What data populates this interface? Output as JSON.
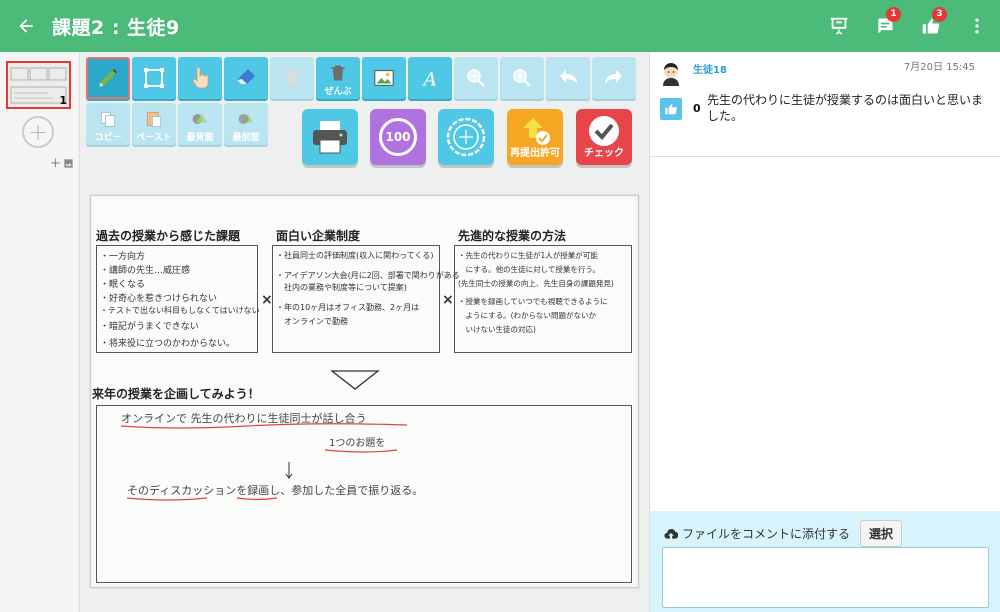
{
  "header": {
    "title": "課題2 : 生徒9",
    "badges": {
      "comments": "1",
      "likes": "3"
    }
  },
  "pages": {
    "current_number": "1"
  },
  "toolbar": {
    "delete_all_label": "ぜんぶ",
    "copy_label": "コピー",
    "paste_label": "ペースト",
    "back_label": "最背面",
    "front_label": "最前面",
    "score_label": "100",
    "resubmit_label": "再提出許可",
    "check_label": "チェック"
  },
  "document": {
    "heading1": "過去の授業から感じた課題",
    "heading2": "面白い企業制度",
    "heading3": "先進的な授業の方法",
    "heading4": "来年の授業を企画してみよう！",
    "cross": "×",
    "col1": [
      "・一方向方",
      "・講師の先生…威圧感",
      "・眠くなる",
      "・好奇心を惹きつけられない",
      "・テストで出ない科目もしなくてはいけない",
      "・暗記がうまくできない",
      "・将来役に立つのかわからない。"
    ],
    "col2": [
      "・社員同士の評価制度(収入に関わってくる)",
      "・アイデアソン大会(月に2回、部署で関わりがある",
      "　社内の業務や制度等について提案)",
      "・年の10ヶ月はオフィス勤務、2ヶ月は",
      "　オンラインで勤務"
    ],
    "col3": [
      "・先生の代わりに生徒が1人が授業が可能",
      "　にする。他の生徒に対して授業を行う。",
      "(先生同士の授業の向上、先生自身の課題発見)",
      "・授業を録画していつでも視聴できるように",
      "　ようにする。(わからない問題がないか",
      "　いけない生徒の対応)"
    ],
    "plan": [
      "オンラインで 先生の代わりに生徒同士が話し合う",
      "1つのお題を",
      "そのディスカッションを録画し、参加した全員で振り返る。"
    ]
  },
  "comment": {
    "author": "生徒18",
    "time": "7月20日 15:45",
    "likes": "0",
    "text": "先生の代わりに生徒が授業するのは面白いと思いました。"
  },
  "attach": {
    "label": "ファイルをコメントに添付する",
    "button": "選択"
  },
  "colors": {
    "appbar": "#4cba79",
    "tool": "#4fc8e6",
    "score": "#b072e0",
    "resubmit": "#f5a623",
    "check": "#e8454a"
  }
}
